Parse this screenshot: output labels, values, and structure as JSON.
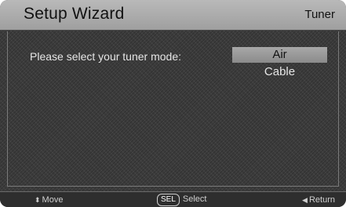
{
  "header": {
    "title": "Setup Wizard",
    "section": "Tuner"
  },
  "main": {
    "prompt": "Please select your tuner mode:",
    "options": [
      {
        "label": "Air",
        "selected": true
      },
      {
        "label": "Cable",
        "selected": false
      }
    ]
  },
  "footer": {
    "move_icon": "up-down-arrow-icon",
    "move_label": "Move",
    "select_key": "SEL",
    "select_label": "Select",
    "return_icon": "left-arrow-icon",
    "return_label": "Return"
  },
  "colors": {
    "header_bg": "#b0b0b0",
    "background": "#3c3c3c",
    "selected_bg": "#9a9a9a",
    "text": "#e6e6e6"
  }
}
